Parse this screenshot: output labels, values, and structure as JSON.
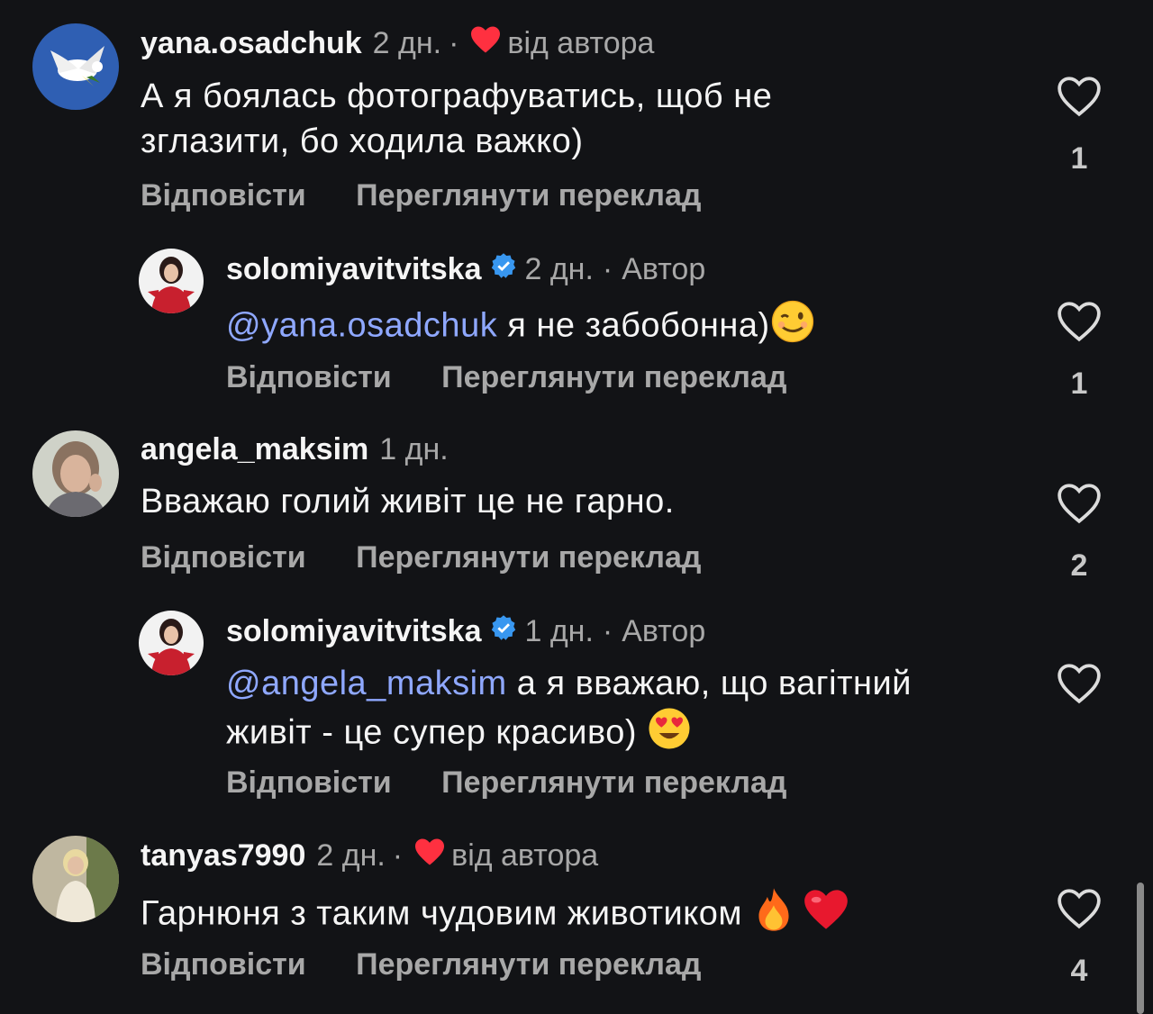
{
  "common": {
    "reply_label": "Відповісти",
    "translate_label": "Переглянути переклад",
    "from_author": "від автора",
    "author_tag": "Автор",
    "dot": "·"
  },
  "comments": [
    {
      "username": "yana.osadchuk",
      "time": "2 дн.",
      "liked_by_author": true,
      "text_line1": "А я боялась фотографуватись, щоб не",
      "text_line2": "зглазити, бо ходила важко)",
      "likes": "1"
    },
    {
      "username": "solomiyavitvitska",
      "time": "2 дн.",
      "verified": true,
      "mention": "@yana.osadchuk",
      "text": " я не забобонна)",
      "emoji": "wink",
      "likes": "1"
    },
    {
      "username": "angela_maksim",
      "time": "1 дн.",
      "text": "Вважаю голий живіт це не гарно.",
      "likes": "2"
    },
    {
      "username": "solomiyavitvitska",
      "time": "1 дн.",
      "verified": true,
      "mention": "@angela_maksim",
      "text_line1": " а я вважаю, що вагітний",
      "text_line2": "живіт - це супер красиво) ",
      "emoji": "heart-eyes",
      "likes": ""
    },
    {
      "username": "tanyas7990",
      "time": "2 дн.",
      "liked_by_author": true,
      "text": "Гарнюня з таким чудовим животиком ",
      "emoji": "fire-heart",
      "likes": "4"
    }
  ],
  "colors": {
    "background": "#121316",
    "mention": "#8fa8ff",
    "heart": "#ff3040",
    "verified": "#3897f0"
  }
}
